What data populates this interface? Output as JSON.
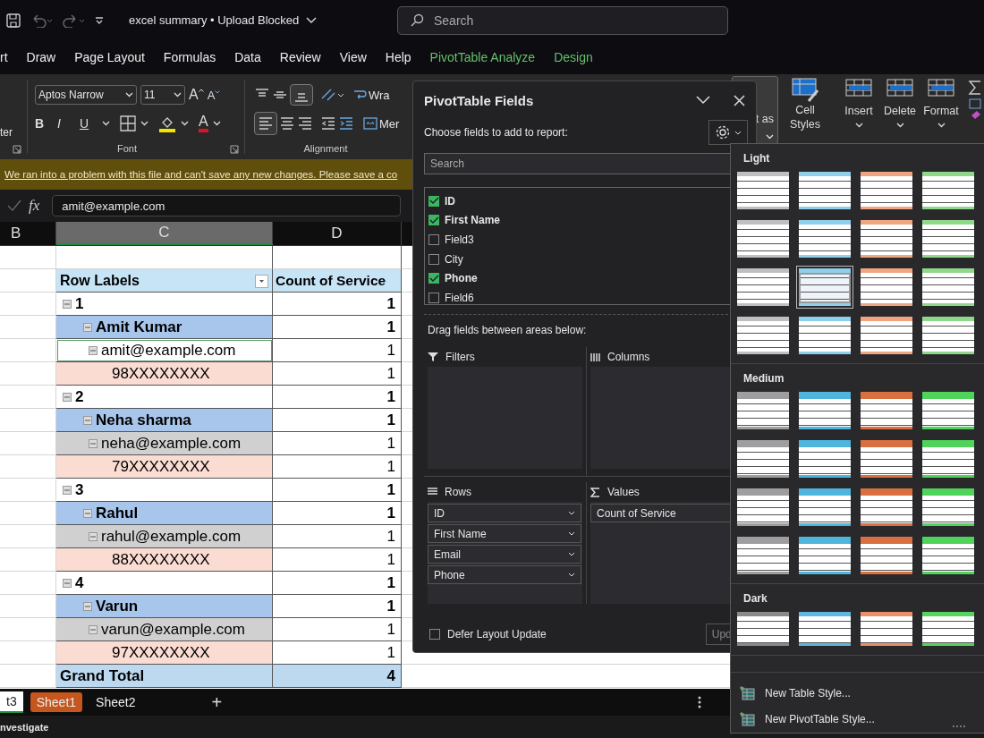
{
  "title_bar": {
    "filename": "excel summary",
    "separator": "•",
    "status": "Upload Blocked",
    "search_placeholder": "Search"
  },
  "menu_tabs": [
    {
      "label": "rt",
      "kind": "normal"
    },
    {
      "label": "Draw",
      "kind": "normal"
    },
    {
      "label": "Page Layout",
      "kind": "normal"
    },
    {
      "label": "Formulas",
      "kind": "normal"
    },
    {
      "label": "Data",
      "kind": "normal"
    },
    {
      "label": "Review",
      "kind": "normal"
    },
    {
      "label": "View",
      "kind": "normal"
    },
    {
      "label": "Help",
      "kind": "normal"
    },
    {
      "label": "PivotTable Analyze",
      "kind": "contextual"
    },
    {
      "label": "Design",
      "kind": "contextual"
    }
  ],
  "ribbon": {
    "cut_label": "ter",
    "font_name": "Aptos Narrow",
    "font_size": "11",
    "grow_font": "A",
    "shrink_font": "A",
    "format_buttons": [
      "B",
      "I",
      "U"
    ],
    "font_color": "A",
    "font_group": "Font",
    "alignment_group": "Alignment",
    "wrap_text": "Wra",
    "merge": "Mer",
    "format_as_table": "t as",
    "cell_styles": "Cell Styles",
    "cells_buttons": [
      "Insert",
      "Delete",
      "Format"
    ]
  },
  "warning": "We ran into a problem with this file and can't save any new changes. Please save a co",
  "formula_bar": {
    "function_label": "fx",
    "value": "amit@example.com"
  },
  "columns": [
    {
      "label": "B",
      "selected": false
    },
    {
      "label": "C",
      "selected": true
    },
    {
      "label": "D",
      "selected": false
    }
  ],
  "pivot_table": {
    "headers": [
      "Row Labels",
      "Count of Service"
    ],
    "rows": [
      {
        "label": "1",
        "count": "1",
        "selected": false,
        "children": [
          {
            "label": "Amit Kumar",
            "count": "1",
            "selected": false,
            "children": [
              {
                "label": "amit@example.com",
                "count": "1",
                "selected": true,
                "children": [
                  {
                    "label": "98XXXXXXXX",
                    "count": "1",
                    "selected": false
                  }
                ]
              }
            ]
          }
        ]
      },
      {
        "label": "2",
        "count": "1",
        "selected": false,
        "children": [
          {
            "label": "Neha sharma",
            "count": "1",
            "selected": false,
            "children": [
              {
                "label": "neha@example.com",
                "count": "1",
                "selected": false,
                "children": [
                  {
                    "label": "79XXXXXXXX",
                    "count": "1",
                    "selected": false
                  }
                ]
              }
            ]
          }
        ]
      },
      {
        "label": "3",
        "count": "1",
        "selected": false,
        "children": [
          {
            "label": "Rahul",
            "count": "1",
            "selected": false,
            "children": [
              {
                "label": "rahul@example.com",
                "count": "1",
                "selected": false,
                "children": [
                  {
                    "label": "88XXXXXXXX",
                    "count": "1",
                    "selected": false
                  }
                ]
              }
            ]
          }
        ]
      },
      {
        "label": "4",
        "count": "1",
        "selected": false,
        "children": [
          {
            "label": "Varun",
            "count": "1",
            "selected": false,
            "children": [
              {
                "label": "varun@example.com",
                "count": "1",
                "selected": false,
                "children": [
                  {
                    "label": "97XXXXXXXX",
                    "count": "1",
                    "selected": false
                  }
                ]
              }
            ]
          }
        ]
      }
    ],
    "grand_total": {
      "label": "Grand Total",
      "count": "4"
    }
  },
  "sheet_tabs": [
    {
      "label": "t3",
      "selected": true
    },
    {
      "label": "Sheet1",
      "selected": false,
      "color": "#c4561e"
    },
    {
      "label": "Sheet2",
      "selected": false
    }
  ],
  "add_sheet": "+",
  "status_bar": "nvestigate",
  "pivot_fields": {
    "title": "PivotTable Fields",
    "prompt": "Choose fields to add to report:",
    "search_placeholder": "Search",
    "fields": [
      {
        "label": "ID",
        "checked": true
      },
      {
        "label": "First Name",
        "checked": true
      },
      {
        "label": "Field3",
        "checked": false
      },
      {
        "label": "City",
        "checked": false
      },
      {
        "label": "Phone",
        "checked": true
      },
      {
        "label": "Field6",
        "checked": false
      }
    ],
    "areas_prompt": "Drag fields between areas below:",
    "areas": [
      {
        "label": "Filters",
        "kind": "filters"
      },
      {
        "label": "Columns",
        "kind": "columns"
      },
      {
        "label": "Rows",
        "kind": "rows",
        "items": [
          "ID",
          "First Name",
          "Email",
          "Phone"
        ]
      },
      {
        "label": "Values",
        "kind": "values",
        "items": [
          "Count of Service"
        ]
      }
    ],
    "defer": {
      "label": "Defer Layout Update",
      "checked": false
    },
    "update_button": "Upd"
  },
  "style_gallery": {
    "sections": [
      {
        "label": "Light",
        "kind": "light",
        "styles": [
          {
            "color": "#bfbfbf",
            "selected": false
          },
          {
            "color": "#8ecfe9",
            "selected": false
          },
          {
            "color": "#f0a581",
            "selected": false
          },
          {
            "color": "#8fd88a",
            "selected": false
          },
          {
            "color": "#bfbfbf",
            "selected": false
          },
          {
            "color": "#8ecfe9",
            "selected": false
          },
          {
            "color": "#f0a581",
            "selected": false
          },
          {
            "color": "#8fd88a",
            "selected": false
          },
          {
            "color": "#bfbfbf",
            "selected": false
          },
          {
            "color": "#8ecfe9",
            "selected": true
          },
          {
            "color": "#f0a581",
            "selected": false
          },
          {
            "color": "#8fd88a",
            "selected": false
          },
          {
            "color": "#bfbfbf",
            "selected": false
          },
          {
            "color": "#8ecfe9",
            "selected": false
          },
          {
            "color": "#f0a581",
            "selected": false
          },
          {
            "color": "#8fd88a",
            "selected": false
          }
        ]
      },
      {
        "label": "Medium",
        "kind": "medium",
        "styles": [
          {
            "color": "#9e9e9e",
            "selected": false
          },
          {
            "color": "#4fb5dc",
            "selected": false
          },
          {
            "color": "#d9703f",
            "selected": false
          },
          {
            "color": "#4fd35a",
            "selected": false
          },
          {
            "color": "#9e9e9e",
            "selected": false
          },
          {
            "color": "#4fb5dc",
            "selected": false
          },
          {
            "color": "#d9703f",
            "selected": false
          },
          {
            "color": "#4fd35a",
            "selected": false
          },
          {
            "color": "#9e9e9e",
            "selected": false
          },
          {
            "color": "#4fb5dc",
            "selected": false
          },
          {
            "color": "#d9703f",
            "selected": false
          },
          {
            "color": "#4fd35a",
            "selected": false
          },
          {
            "color": "#9e9e9e",
            "selected": false
          },
          {
            "color": "#4fb5dc",
            "selected": false
          },
          {
            "color": "#d9703f",
            "selected": false
          },
          {
            "color": "#4fd35a",
            "selected": false
          }
        ]
      },
      {
        "label": "Dark",
        "kind": "dark",
        "styles": [
          {
            "color": "#8a8a8a",
            "selected": false
          },
          {
            "color": "#5fb6e0",
            "selected": false
          },
          {
            "color": "#e8906a",
            "selected": false
          },
          {
            "color": "#56d45f",
            "selected": false
          }
        ]
      }
    ],
    "actions": [
      "New Table Style...",
      "New PivotTable Style..."
    ]
  }
}
